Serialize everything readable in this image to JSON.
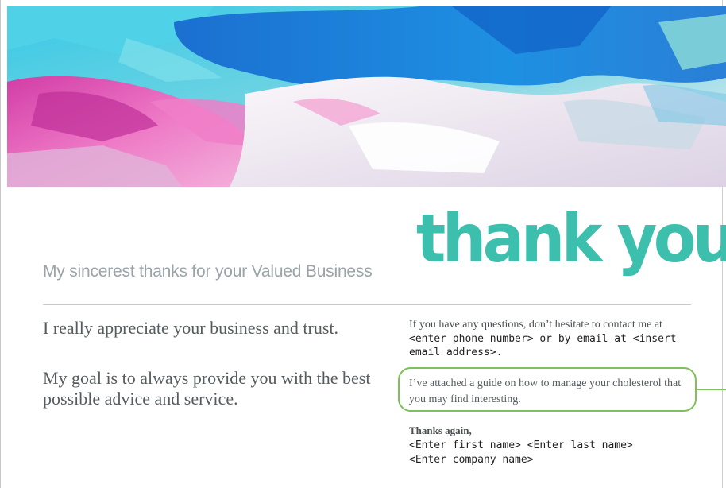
{
  "banner": {
    "image": "abstract-paint-banner",
    "colors": [
      "#1e86d8",
      "#33c6e0",
      "#e65fb6",
      "#f4eef4",
      "#7dd0dc"
    ]
  },
  "heading": {
    "thank_you": "thank you",
    "subtitle": "My sincerest thanks for your Valued Business",
    "accent_color": "#3dbfae"
  },
  "body": {
    "line1": "I really appreciate your business and trust.",
    "line2": "My goal is to always provide you with the best possible advice and service."
  },
  "contact": {
    "intro": "If you have any questions, don’t hesitate to contact me at",
    "placeholder_line1": "<enter phone number> or by email at <insert",
    "placeholder_line2": "email address>.",
    "guide": "I’ve attached a guide on how to manage your cholesterol that you may find interesting.",
    "signoff": "Thanks again,",
    "name": "<Enter first name> <Enter last name>",
    "company": "<Enter company name>"
  },
  "annotation": {
    "highlight_color": "#7fc05a"
  }
}
